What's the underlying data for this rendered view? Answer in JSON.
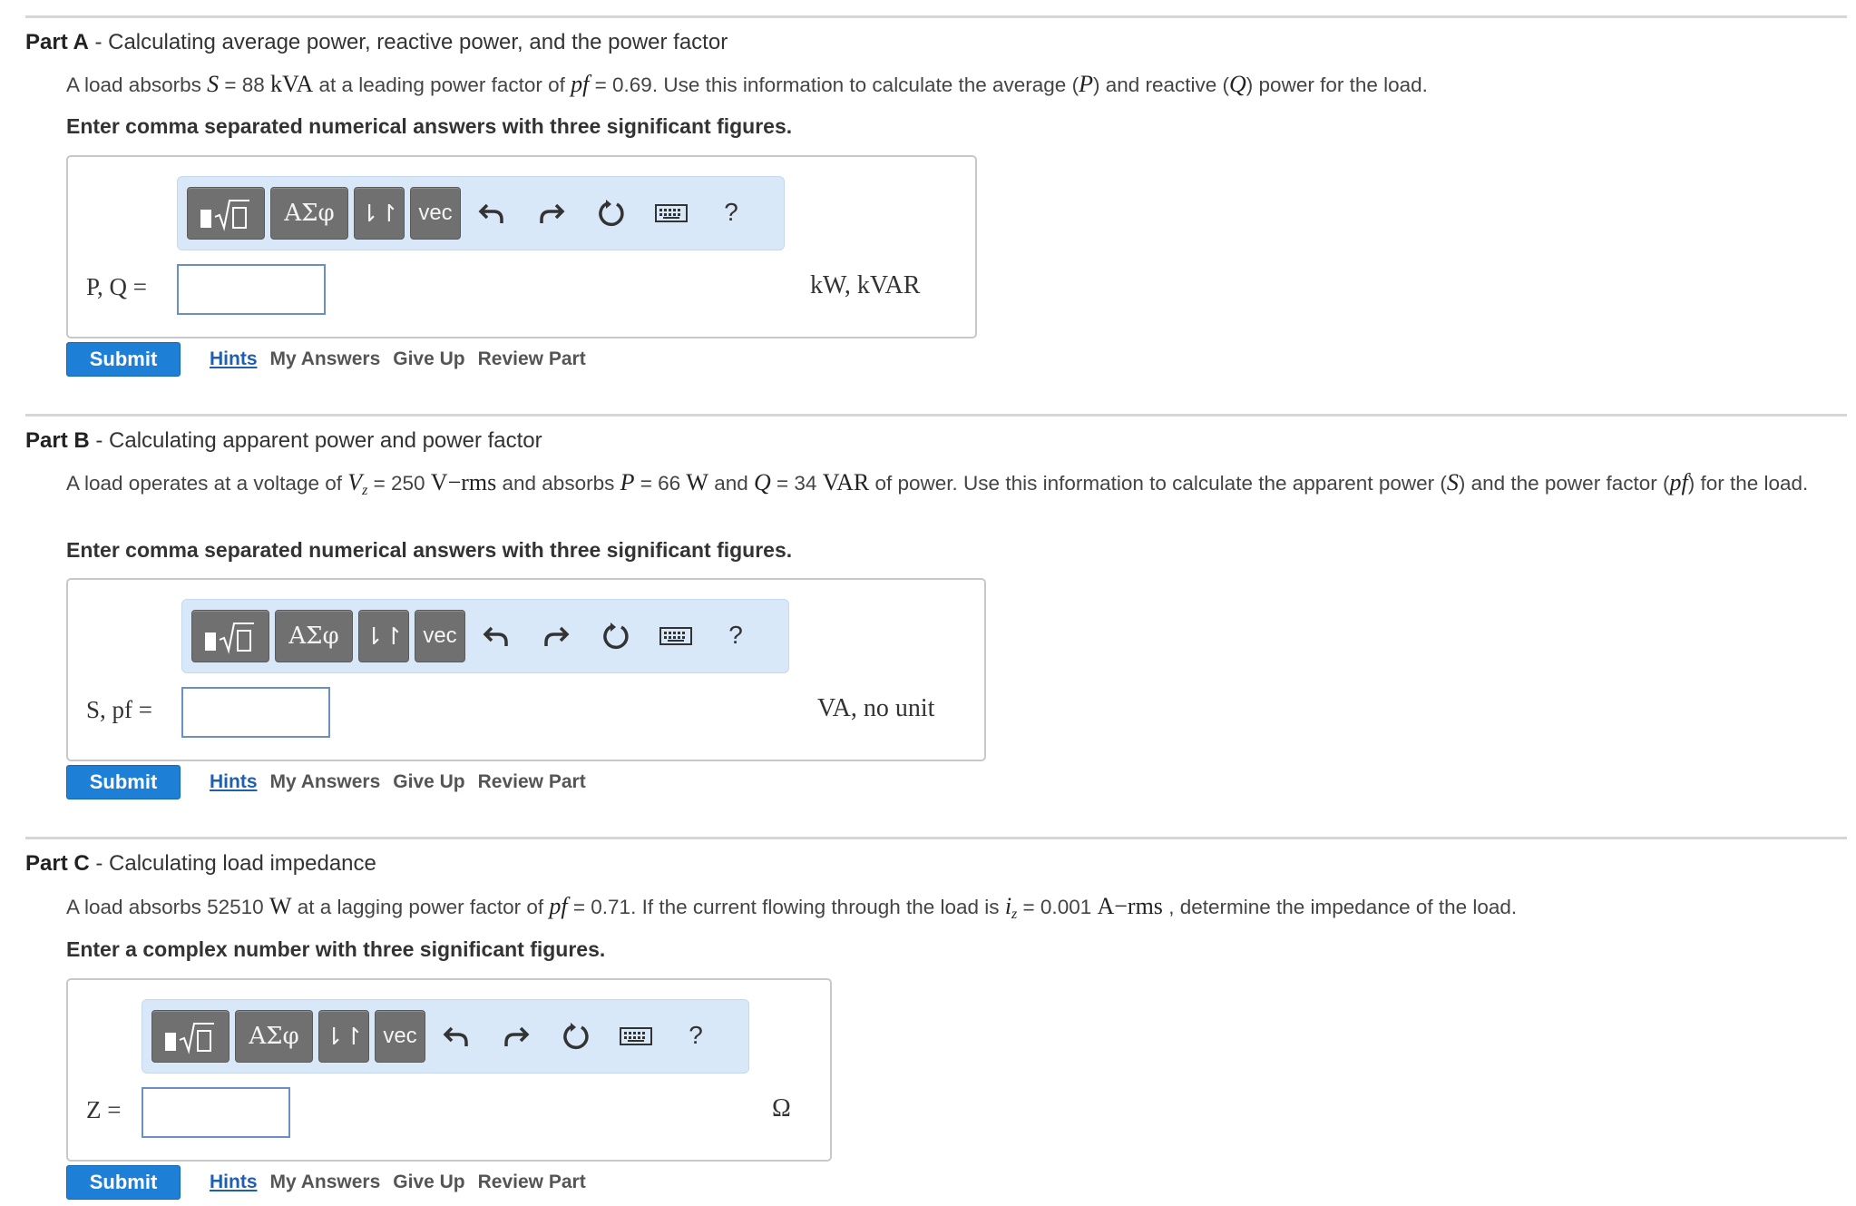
{
  "parts": [
    {
      "label": "Part A",
      "title": "Calculating average power, reactive power, and the power factor",
      "prompt": {
        "t1": "A load absorbs ",
        "m1": "S",
        "t2": " = 88 ",
        "m2": "kVA",
        "t3": " at a leading power factor of ",
        "m3": "pf",
        "t4": " = 0.69. Use this information to calculate the average (",
        "m4": "P",
        "t5": ") and reactive (",
        "m5": "Q",
        "t6": ") power for the load."
      },
      "instruction": "Enter comma separated numerical answers with three significant figures.",
      "var_label": "P, Q =",
      "input_value": "",
      "units": "kW, kVAR"
    },
    {
      "label": "Part B",
      "title": "Calculating apparent power and power factor",
      "prompt": {
        "t1": "A load operates at a voltage of ",
        "m1": "V",
        "m1sub": "z",
        "t2": " = 250 ",
        "m2": "V−rms",
        "t3": " and absorbs ",
        "m3": "P",
        "t4": " = 66 ",
        "m4": "W",
        "t5": " and ",
        "m5": "Q",
        "t6": " = 34 ",
        "m6": "VAR",
        "t7": " of power. Use this information to calculate the apparent power (",
        "m7": "S",
        "t8": ") and the power factor (",
        "m8": "pf",
        "t9": ") for the load."
      },
      "instruction": "Enter comma separated numerical answers with three significant figures.",
      "var_label": "S, pf =",
      "input_value": "",
      "units": "VA, no unit"
    },
    {
      "label": "Part C",
      "title": "Calculating load impedance",
      "prompt": {
        "t1": "A load absorbs 52510 ",
        "m1": "W",
        "t2": "  at a lagging power factor of ",
        "m2": "pf",
        "t3": " = 0.71. If the current flowing through the load is ",
        "m3": "i",
        "m3sub": "z",
        "t4": " = 0.001 ",
        "m4": "A−rms",
        "t5": " , determine the impedance of the load."
      },
      "instruction": "Enter a complex number with three significant figures.",
      "var_label": "Z =",
      "input_value": "",
      "units": "Ω"
    }
  ],
  "toolbar": {
    "templates_icon": "fraction-sqrt-template-icon",
    "greek_label": "ΑΣφ",
    "arrows_label": "⇂↾",
    "vec_label": "vec",
    "undo_icon": "undo-icon",
    "redo_icon": "redo-icon",
    "reset_icon": "reset-icon",
    "keyboard_icon": "keyboard-icon",
    "help_label": "?"
  },
  "actions": {
    "submit": "Submit",
    "hints": "Hints",
    "my_answers": "My Answers",
    "give_up": "Give Up",
    "review_part": "Review Part"
  },
  "colors": {
    "submit_bg": "#1e7fd6",
    "toolbar_bg": "#d9e8f8",
    "toolbar_button": "#707070",
    "link": "#1e5fb0"
  }
}
